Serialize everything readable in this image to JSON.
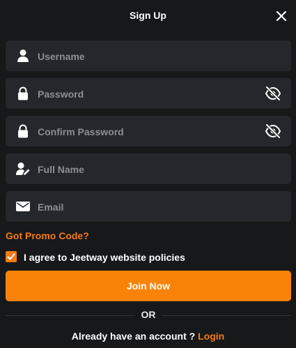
{
  "header": {
    "title": "Sign Up"
  },
  "fields": {
    "username": {
      "placeholder": "Username",
      "value": ""
    },
    "password": {
      "placeholder": "Password",
      "value": ""
    },
    "confirm_password": {
      "placeholder": "Confirm Password",
      "value": ""
    },
    "full_name": {
      "placeholder": "Full Name",
      "value": ""
    },
    "email": {
      "placeholder": "Email",
      "value": ""
    }
  },
  "promo": {
    "label": "Got Promo Code?"
  },
  "agreement": {
    "label": "I agree to Jeetway website policies",
    "checked": true
  },
  "join_button": {
    "label": "Join Now"
  },
  "divider": {
    "label": "OR"
  },
  "footer": {
    "prompt": "Already have an account ? ",
    "login_label": "Login"
  },
  "colors": {
    "accent": "#f98309",
    "background": "#17181a",
    "field_bg": "#24272b"
  },
  "icons": [
    "close-icon",
    "user-icon",
    "lock-icon",
    "eye-slash-icon",
    "user-edit-icon",
    "envelope-icon",
    "checkmark-icon"
  ]
}
